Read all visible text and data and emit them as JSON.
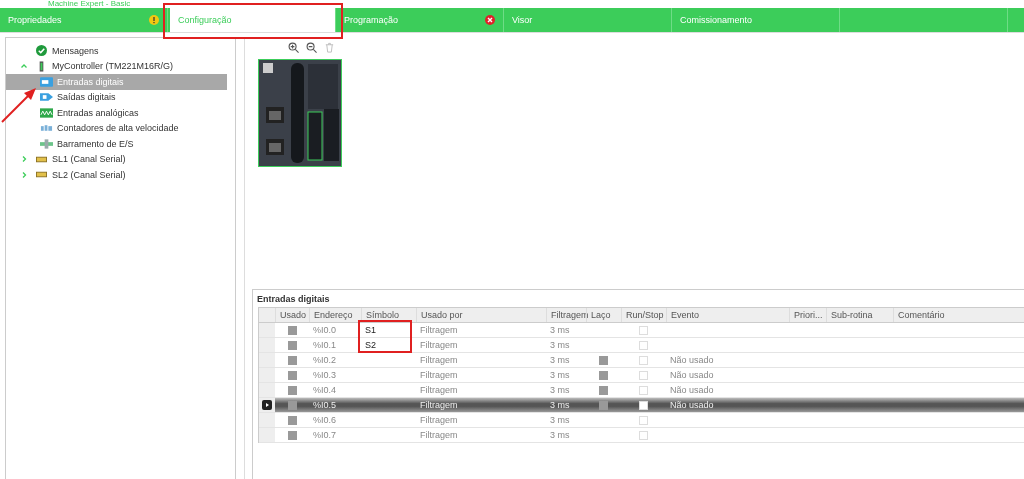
{
  "window": {
    "title": "Machine Expert - Basic"
  },
  "tabs": [
    {
      "label": "Propriedades",
      "selected": false,
      "warning": true,
      "error": false
    },
    {
      "label": "Configuração",
      "selected": true,
      "warning": false,
      "error": false
    },
    {
      "label": "Programação",
      "selected": false,
      "warning": false,
      "error": true
    },
    {
      "label": "Visor",
      "selected": false,
      "warning": false,
      "error": false
    },
    {
      "label": "Comissionamento",
      "selected": false,
      "warning": false,
      "error": false
    }
  ],
  "tree": [
    {
      "label": "Mensagens",
      "kind": "messages",
      "selected": false
    },
    {
      "label": "MyController (TM221M16R/G)",
      "kind": "controller",
      "selected": false,
      "expanded": true,
      "children": [
        {
          "label": "Entradas digitais",
          "kind": "digital_in",
          "selected": true
        },
        {
          "label": "Saídas digitais",
          "kind": "digital_out",
          "selected": false
        },
        {
          "label": "Entradas analógicas",
          "kind": "analog_in",
          "selected": false
        },
        {
          "label": "Contadores de alta velocidade",
          "kind": "counter",
          "selected": false
        },
        {
          "label": "Barramento de E/S",
          "kind": "bus",
          "selected": false
        }
      ]
    },
    {
      "label": "SL1 (Canal Serial)",
      "kind": "serial",
      "selected": false,
      "expanded": false
    },
    {
      "label": "SL2 (Canal Serial)",
      "kind": "serial",
      "selected": false,
      "expanded": false
    }
  ],
  "table": {
    "title": "Entradas digitais",
    "columns": [
      "Usado",
      "Endereço",
      "Símbolo",
      "Usado por",
      "Filtragem",
      "Laço",
      "Run/Stop",
      "Evento",
      "Priori...",
      "Sub-rotina",
      "Comentário"
    ],
    "rows": [
      {
        "used": true,
        "address": "%I0.0",
        "symbol": "S1",
        "used_by": "Filtragem",
        "filter": "3 ms",
        "loop": false,
        "run_stop": false,
        "event": "",
        "selected": false
      },
      {
        "used": true,
        "address": "%I0.1",
        "symbol": "S2",
        "used_by": "Filtragem",
        "filter": "3 ms",
        "loop": false,
        "run_stop": false,
        "event": "",
        "selected": false
      },
      {
        "used": true,
        "address": "%I0.2",
        "symbol": "",
        "used_by": "Filtragem",
        "filter": "3 ms",
        "loop": true,
        "run_stop": false,
        "event": "Não usado",
        "selected": false
      },
      {
        "used": true,
        "address": "%I0.3",
        "symbol": "",
        "used_by": "Filtragem",
        "filter": "3 ms",
        "loop": true,
        "run_stop": false,
        "event": "Não usado",
        "selected": false
      },
      {
        "used": true,
        "address": "%I0.4",
        "symbol": "",
        "used_by": "Filtragem",
        "filter": "3 ms",
        "loop": true,
        "run_stop": false,
        "event": "Não usado",
        "selected": false
      },
      {
        "used": true,
        "address": "%I0.5",
        "symbol": "",
        "used_by": "Filtragem",
        "filter": "3 ms",
        "loop": true,
        "run_stop": false,
        "event": "Não usado",
        "selected": true
      },
      {
        "used": true,
        "address": "%I0.6",
        "symbol": "",
        "used_by": "Filtragem",
        "filter": "3 ms",
        "loop": false,
        "run_stop": false,
        "event": "",
        "selected": false
      },
      {
        "used": true,
        "address": "%I0.7",
        "symbol": "",
        "used_by": "Filtragem",
        "filter": "3 ms",
        "loop": false,
        "run_stop": false,
        "event": "",
        "selected": false
      }
    ]
  }
}
